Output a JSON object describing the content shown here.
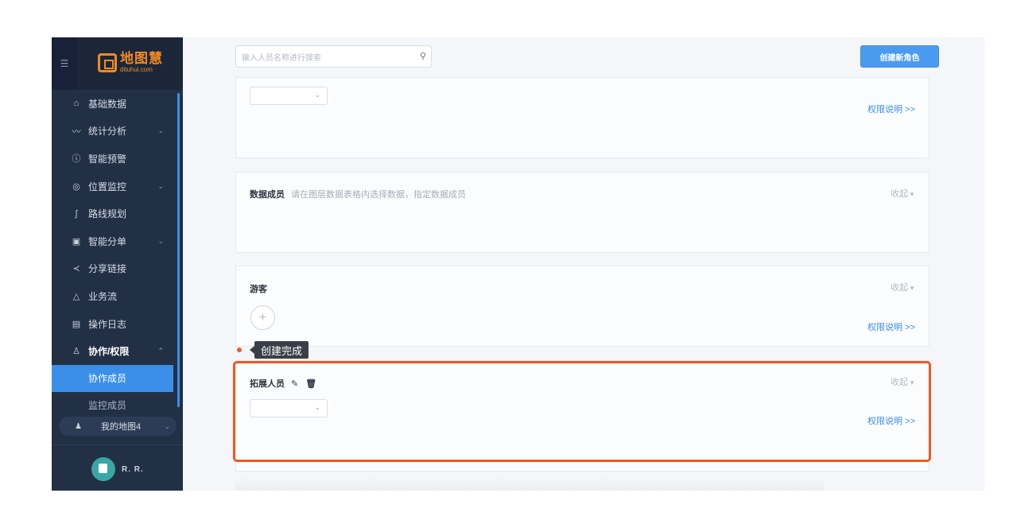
{
  "sidebar": {
    "logo": {
      "main": "地图慧",
      "sub": "dituhui.com"
    },
    "menu": [
      {
        "label": "基础数据",
        "icon": "home-icon"
      },
      {
        "label": "统计分析",
        "icon": "trend-icon",
        "expandable": true
      },
      {
        "label": "智能预警",
        "icon": "info-circle-icon"
      },
      {
        "label": "位置监控",
        "icon": "location-icon",
        "expandable": true
      },
      {
        "label": "路线规划",
        "icon": "route-icon"
      },
      {
        "label": "智能分单",
        "icon": "dispatch-icon",
        "expandable": true
      },
      {
        "label": "分享链接",
        "icon": "share-icon"
      },
      {
        "label": "业务流",
        "icon": "workflow-icon"
      },
      {
        "label": "操作日志",
        "icon": "calendar-icon"
      },
      {
        "label": "协作/权限",
        "icon": "users-icon",
        "expandable": true,
        "expanded": true
      }
    ],
    "submenu": [
      {
        "label": "协作成员",
        "active": true
      },
      {
        "label": "监控成员",
        "active": false
      }
    ],
    "map_selector": {
      "label": "我的地图4"
    },
    "user": {
      "name": "R. R."
    }
  },
  "header": {
    "search": {
      "placeholder": "输入人员名称进行搜索",
      "value": ""
    },
    "create_role_label": "创建新角色"
  },
  "panels": {
    "top": {
      "perm_link": "权限说明 >>"
    },
    "data_members": {
      "title": "数据成员",
      "hint": "请在图层数据表格内选择数据，指定数据成员",
      "collapse": "收起"
    },
    "guest": {
      "title": "游客",
      "collapse": "收起",
      "add": "+",
      "perm_link": "权限说明 >>"
    },
    "expand_staff": {
      "title": "拓展人员",
      "collapse": "收起",
      "perm_link": "权限说明 >>"
    }
  },
  "tooltip": {
    "text": "创建完成"
  },
  "colors": {
    "accent": "#3c8fe8",
    "highlight": "#ec5a26",
    "sidebar": "#223046",
    "logo": "#f08a24"
  }
}
